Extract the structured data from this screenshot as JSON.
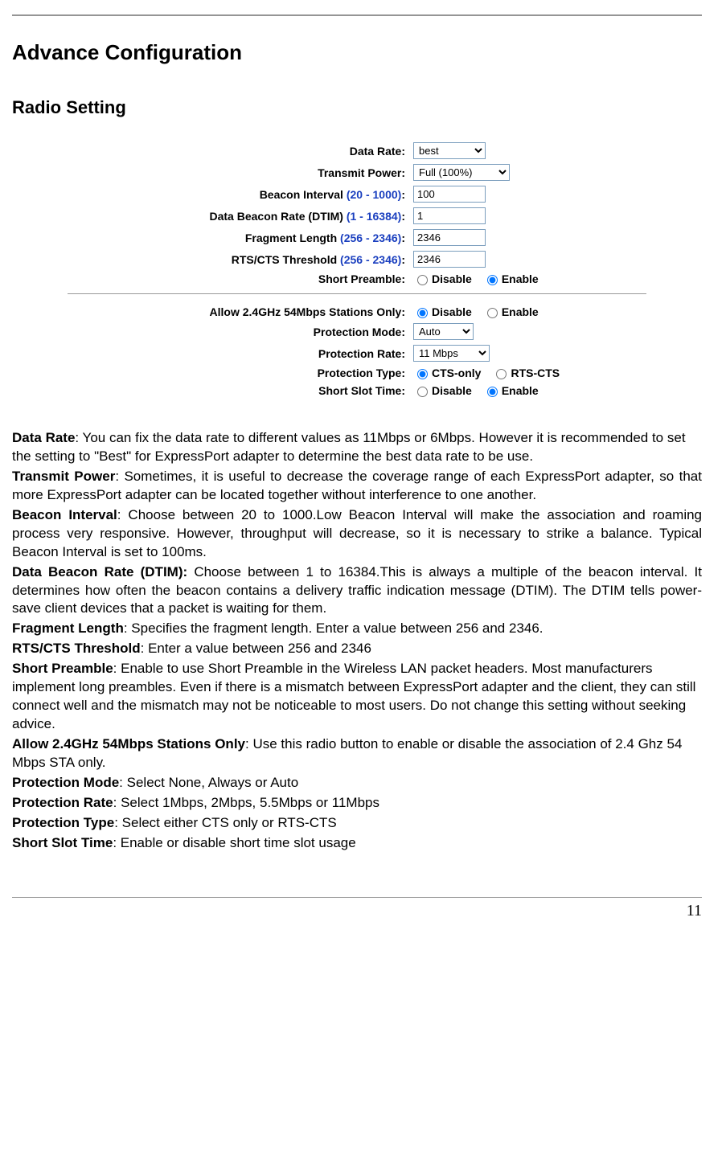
{
  "page_number": "11",
  "headings": {
    "h1": "Advance Configuration",
    "h2": "Radio Setting"
  },
  "form": {
    "data_rate": {
      "label": "Data Rate:",
      "value": "best"
    },
    "transmit_power": {
      "label": "Transmit Power:",
      "value": "Full (100%)"
    },
    "beacon_interval": {
      "label_main": "Beacon Interval ",
      "label_range": "(20 - 1000)",
      "label_suffix": ":",
      "value": "100"
    },
    "dtim": {
      "label_main": "Data Beacon Rate (DTIM) ",
      "label_range": "(1 - 16384)",
      "label_suffix": ":",
      "value": "1"
    },
    "fragment_length": {
      "label_main": "Fragment Length ",
      "label_range": "(256 - 2346)",
      "label_suffix": ":",
      "value": "2346"
    },
    "rts_cts": {
      "label_main": "RTS/CTS Threshold ",
      "label_range": "(256 - 2346)",
      "label_suffix": ":",
      "value": "2346"
    },
    "short_preamble": {
      "label": "Short Preamble:",
      "disable": "Disable",
      "enable": "Enable",
      "selected": "enable"
    },
    "allow_54": {
      "label": "Allow 2.4GHz 54Mbps Stations Only:",
      "disable": "Disable",
      "enable": "Enable",
      "selected": "disable"
    },
    "protection_mode": {
      "label": "Protection Mode:",
      "value": "Auto"
    },
    "protection_rate": {
      "label": "Protection Rate:",
      "value": "11 Mbps"
    },
    "protection_type": {
      "label": "Protection Type:",
      "opt1": "CTS-only",
      "opt2": "RTS-CTS",
      "selected": "cts"
    },
    "short_slot": {
      "label": "Short Slot Time:",
      "disable": "Disable",
      "enable": "Enable",
      "selected": "enable"
    }
  },
  "desc": {
    "data_rate_b": "Data Rate",
    "data_rate_t": ": You can fix the data rate to different values as 11Mbps or 6Mbps. However it is recommended to set the setting to \"Best\" for ExpressPort adapter to determine the best data rate to be use.",
    "transmit_power_b": "Transmit Power",
    "transmit_power_t": ": Sometimes, it is useful to decrease the coverage range of each ExpressPort adapter, so that more ExpressPort adapter can be located together without interference to one another.",
    "beacon_interval_b": "Beacon Interval",
    "beacon_interval_t": ": Choose between 20 to 1000.Low Beacon Interval will make the association and roaming process very responsive. However, throughput will decrease, so it is necessary to strike a balance. Typical Beacon Interval is set to 100ms.",
    "dtim_b": "Data Beacon Rate (DTIM):",
    "dtim_t": " Choose between 1 to 16384.This is always a multiple of the beacon interval. It determines how often the beacon contains a delivery traffic indication message (DTIM). The DTIM tells power-save client devices that a packet is waiting for them.",
    "fragment_length_b": "Fragment Length",
    "fragment_length_t": ": Specifies the fragment length. Enter a value between 256 and 2346.",
    "rts_cts_b": "RTS/CTS Threshold",
    "rts_cts_t": ": Enter a value between 256 and 2346",
    "short_preamble_b": "Short Preamble",
    "short_preamble_t": ": Enable to use Short Preamble in the Wireless LAN packet headers. Most manufacturers implement long preambles. Even if there is a mismatch between ExpressPort adapter and the client, they can still connect well and the mismatch may not be noticeable to most users. Do not change this setting without seeking advice.",
    "allow_54_b": "Allow 2.4GHz 54Mbps Stations Only",
    "allow_54_t": ": Use this radio button to enable or disable the association of 2.4 Ghz 54 Mbps STA only.",
    "protection_mode_b": "Protection Mode",
    "protection_mode_t": ": Select None, Always or Auto",
    "protection_rate_b": "Protection Rate",
    "protection_rate_t": ": Select 1Mbps, 2Mbps, 5.5Mbps or 11Mbps",
    "protection_type_b": "Protection Type",
    "protection_type_t": ": Select either CTS only or RTS-CTS",
    "short_slot_b": "Short Slot Time",
    "short_slot_t": ": Enable or disable short time slot usage"
  }
}
